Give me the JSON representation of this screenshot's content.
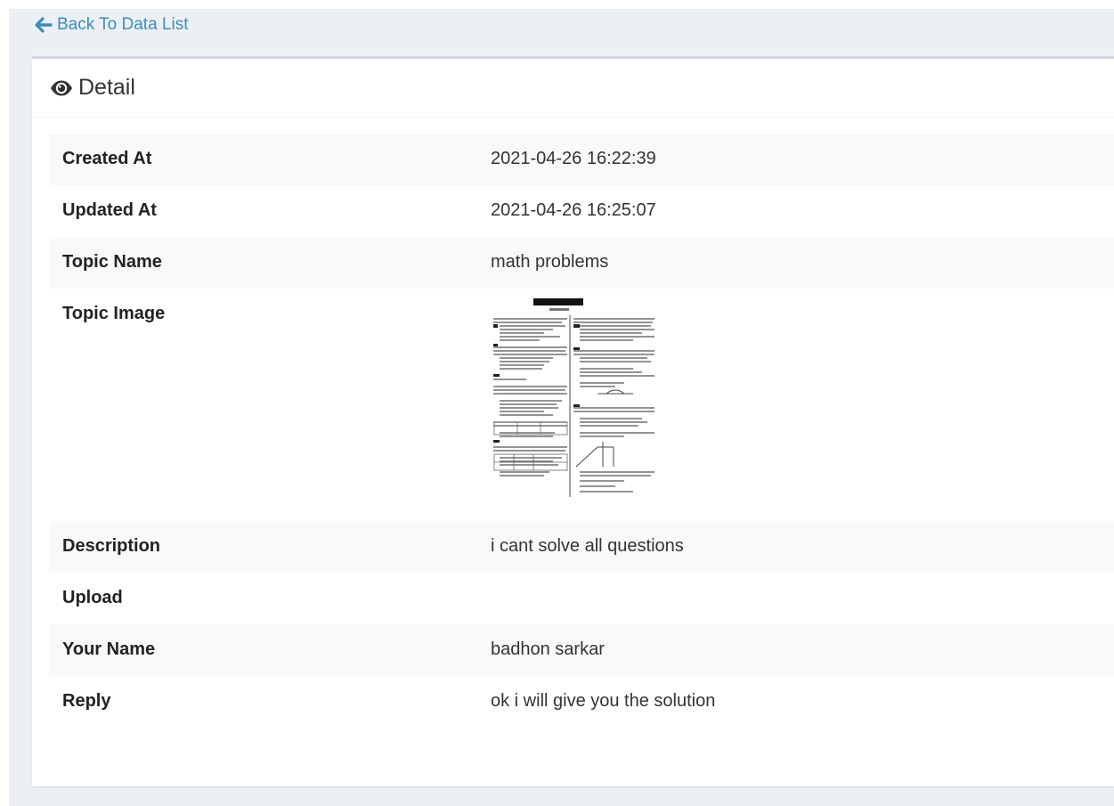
{
  "nav": {
    "back_label": "Back To Data List"
  },
  "panel": {
    "title": "Detail"
  },
  "rows": [
    {
      "label": "Created At",
      "value": "2021-04-26 16:22:39"
    },
    {
      "label": "Updated At",
      "value": "2021-04-26 16:25:07"
    },
    {
      "label": "Topic Name",
      "value": "math problems"
    },
    {
      "label": "Topic Image",
      "value": ""
    },
    {
      "label": "Description",
      "value": "i cant solve all questions"
    },
    {
      "label": "Upload",
      "value": ""
    },
    {
      "label": "Your Name",
      "value": "badhon sarkar"
    },
    {
      "label": "Reply",
      "value": "ok i will give you the solution"
    }
  ],
  "colors": {
    "link": "#3c8dbc",
    "background": "#ecf0f5",
    "panel_border": "#d2d6de",
    "row_stripe": "#f9f9f9"
  },
  "icons": {
    "back": "arrow-left-icon",
    "detail": "eye-icon",
    "topic_image": "topic-image-thumbnail"
  }
}
